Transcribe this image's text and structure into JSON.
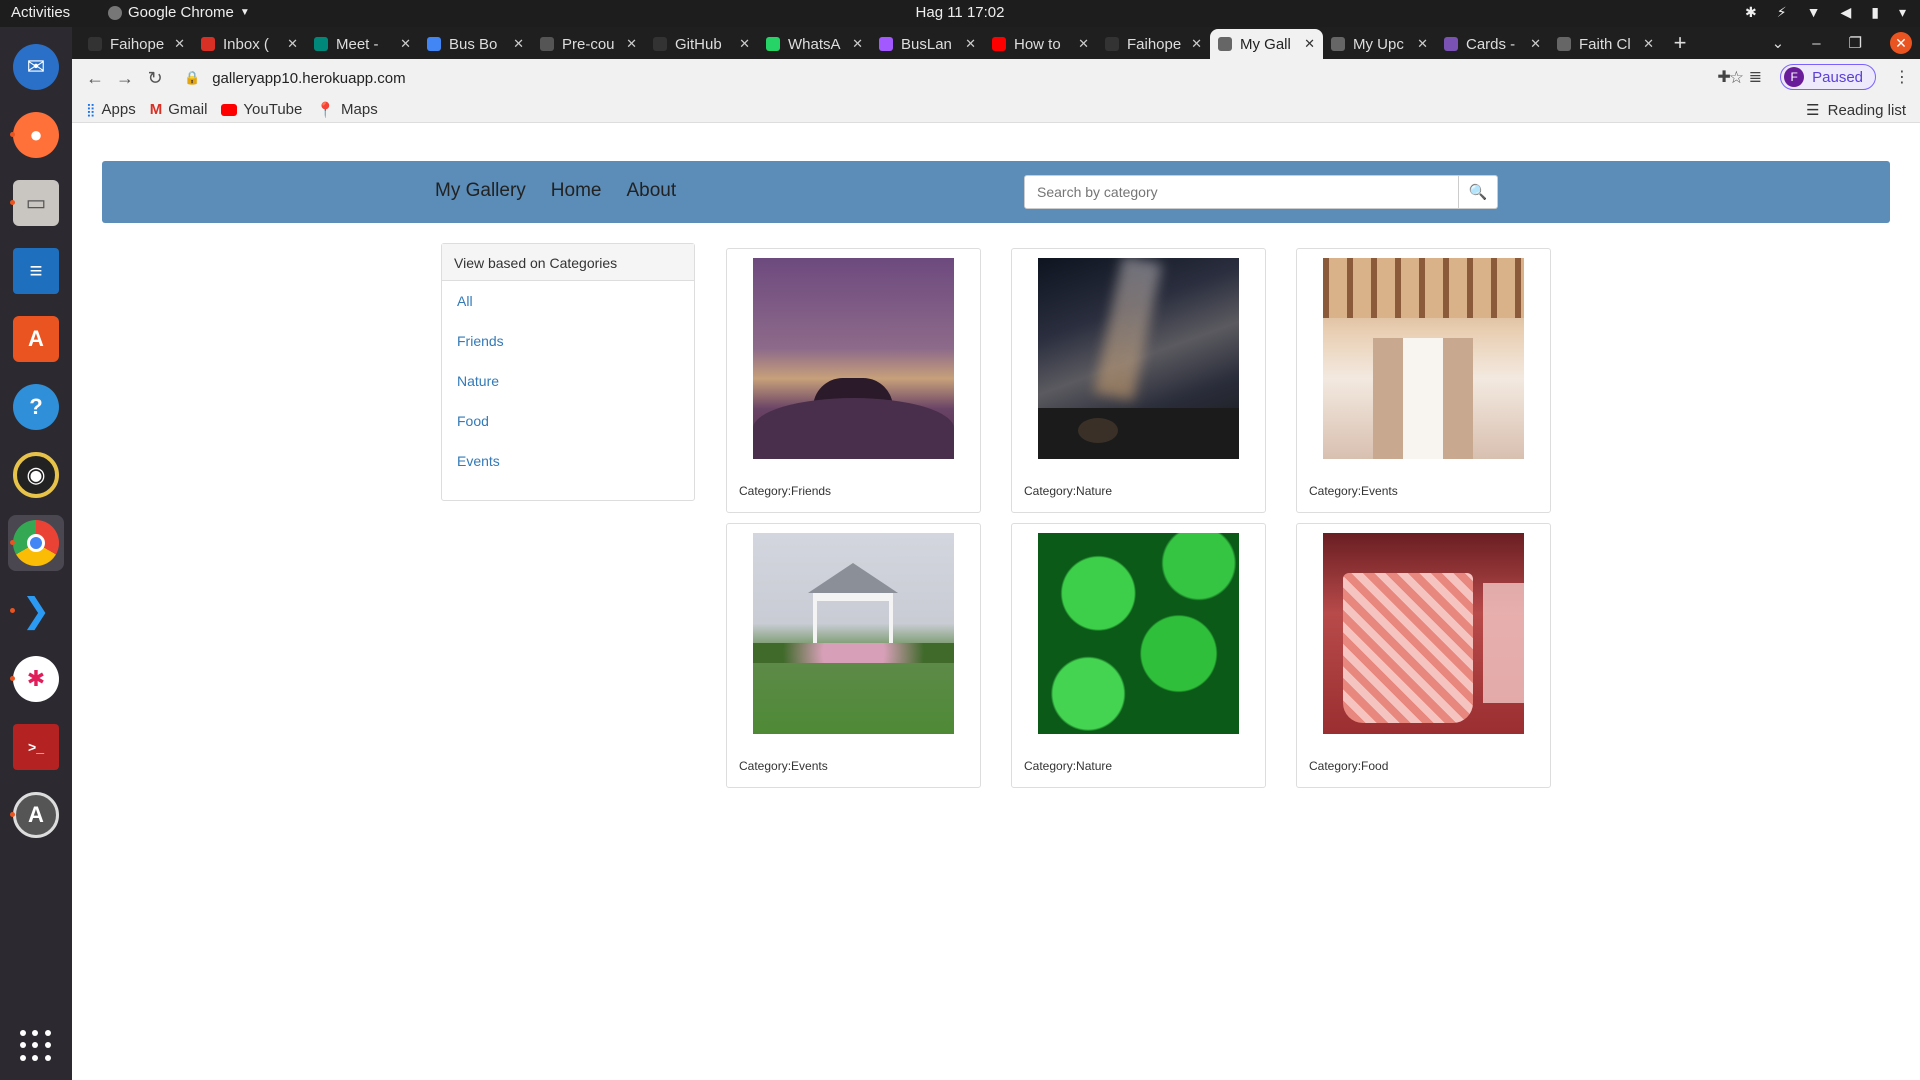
{
  "system": {
    "activities": "Activities",
    "app_name": "Google Chrome",
    "clock": "Hag 11  17:02"
  },
  "browser": {
    "tabs": [
      {
        "title": "Faihope",
        "favicon_color": "#333333"
      },
      {
        "title": "Inbox (",
        "favicon_color": "#d93025"
      },
      {
        "title": "Meet -",
        "favicon_color": "#00897b"
      },
      {
        "title": "Bus Bo",
        "favicon_color": "#4285f4"
      },
      {
        "title": "Pre-cou",
        "favicon_color": "#555555"
      },
      {
        "title": "GitHub",
        "favicon_color": "#333333"
      },
      {
        "title": "WhatsA",
        "favicon_color": "#25d366"
      },
      {
        "title": "BusLan",
        "favicon_color": "#a259ff"
      },
      {
        "title": "How to",
        "favicon_color": "#ff0000"
      },
      {
        "title": "Faihope",
        "favicon_color": "#333333"
      },
      {
        "title": "My Gall",
        "favicon_color": "#666666"
      },
      {
        "title": "My Upc",
        "favicon_color": "#666666"
      },
      {
        "title": "Cards -",
        "favicon_color": "#7952b3"
      },
      {
        "title": "Faith Cl",
        "favicon_color": "#666666"
      }
    ],
    "active_tab_index": 10,
    "url": "galleryapp10.herokuapp.com",
    "profile_initial": "F",
    "profile_status": "Paused",
    "bookmarks": [
      {
        "label": "Apps",
        "icon": "apps-grid-icon"
      },
      {
        "label": "Gmail",
        "icon": "gmail-icon"
      },
      {
        "label": "YouTube",
        "icon": "youtube-icon"
      },
      {
        "label": "Maps",
        "icon": "maps-icon"
      }
    ],
    "reading_list": "Reading list"
  },
  "app": {
    "nav": {
      "brand": "My Gallery",
      "home": "Home",
      "about": "About"
    },
    "search": {
      "placeholder": "Search by category"
    },
    "categories": {
      "heading": "View based on Categories",
      "items": [
        "All",
        "Friends",
        "Nature",
        "Food",
        "Events"
      ]
    },
    "gallery": [
      {
        "caption": "Category:Friends",
        "theme": "sunset-friends"
      },
      {
        "caption": "Category:Nature",
        "theme": "milky-way"
      },
      {
        "caption": "Category:Events",
        "theme": "banquet-hall"
      },
      {
        "caption": "Category:Events",
        "theme": "gazebo"
      },
      {
        "caption": "Category:Nature",
        "theme": "green-leaves"
      },
      {
        "caption": "Category:Food",
        "theme": "pink-drink"
      }
    ]
  },
  "colors": {
    "navbar": "#5b8db8",
    "link": "#337ab7",
    "dock": "#2c2a30",
    "ubuntu_orange": "#e95420"
  }
}
